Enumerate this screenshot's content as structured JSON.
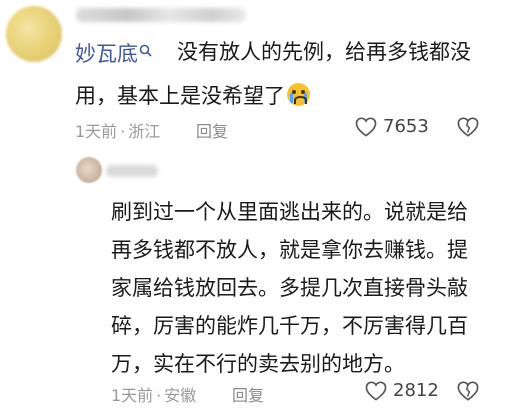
{
  "comment": {
    "mention": "妙瓦底",
    "line1": "没有放人的先例，给再多钱都没",
    "line2": "用，基本上是没希望了",
    "time": "1天前",
    "location": "浙江",
    "reply_label": "回复",
    "likes": "7653"
  },
  "reply": {
    "lines": [
      "刷到过一个从里面逃出来的。说就是给",
      "再多钱都不放人，就是拿你去赚钱。提",
      "家属给钱放回去。多提几次直接骨头敲",
      "碎，厉害的能炸几千万，不厉害得几百",
      "万，实在不行的卖去别的地方。"
    ],
    "time": "1天前",
    "location": "安徽",
    "reply_label": "回复",
    "likes": "2812"
  },
  "icons": {
    "search_small": "search-icon",
    "crying_emoji": "crying-face-icon",
    "like": "heart-icon",
    "dislike": "broken-heart-icon"
  },
  "colors": {
    "mention": "#3e5a9c",
    "meta": "#9a9a9a",
    "text": "#1a1a1a"
  }
}
